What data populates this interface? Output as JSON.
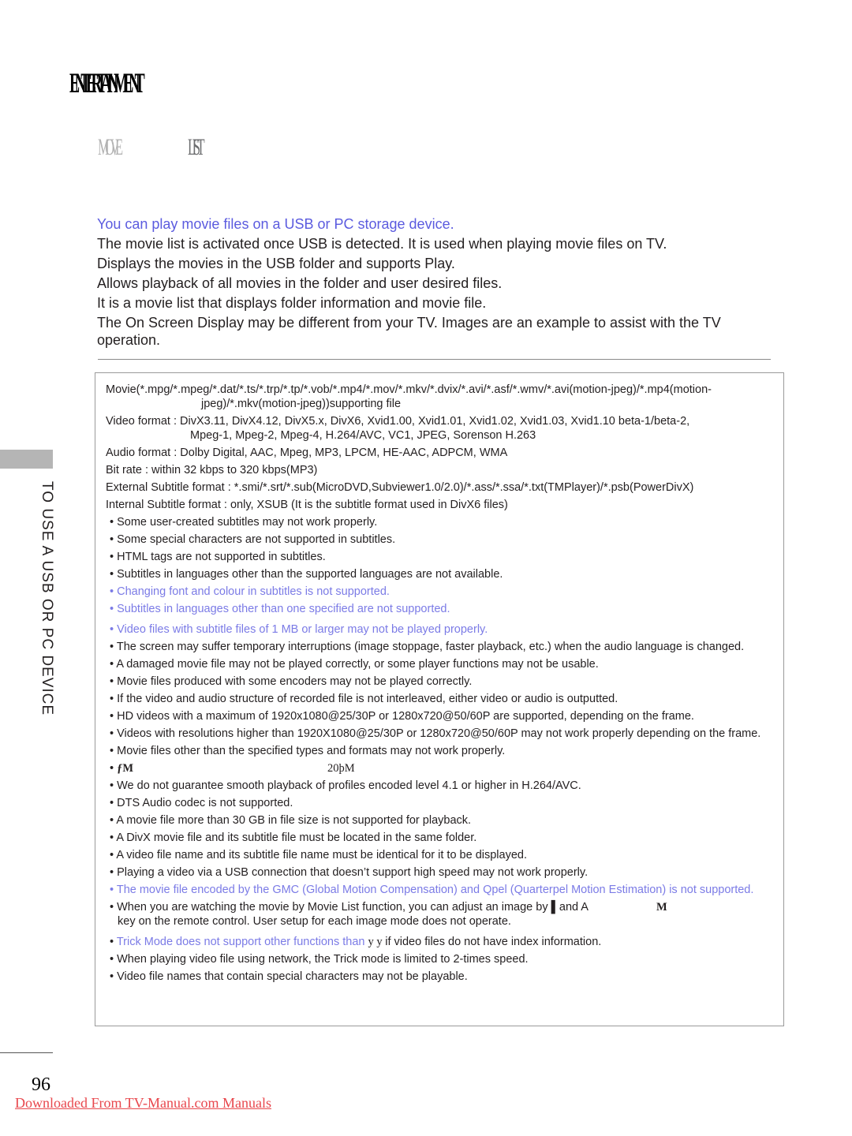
{
  "header": {
    "section_title": "ENTERTAINMENT",
    "subtitle_left": "MOVIE",
    "subtitle_right": "LIST"
  },
  "intro": {
    "lead": "You can play movie files on a USB or PC storage device.",
    "lines": [
      "The movie list is activated once USB is detected. It is used when playing movie files on TV.",
      "Displays the movies in the USB folder and supports Play.",
      "Allows playback of all movies in the folder and user desired files.",
      "It is a movie list that displays folder information and movie file.",
      "The On Screen Display may be different from your TV. Images are an example to assist with the TV operation."
    ]
  },
  "specs": {
    "movie_line1": "Movie(*.mpg/*.mpeg/*.dat/*.ts/*.trp/*.tp/*.vob/*.mp4/*.mov/*.mkv/*.dvix/*.avi/*.asf/*.wmv/*.avi(motion-jpeg)/*.mp4(motion-",
    "movie_line2": "jpeg)/*.mkv(motion-jpeg))supporting file",
    "video_line1": "Video format : DivX3.11, DivX4.12, DivX5.x, DivX6, Xvid1.00, Xvid1.01, Xvid1.02, Xvid1.03, Xvid1.10 beta-1/beta-2,",
    "video_line2": "Mpeg-1, Mpeg-2, Mpeg-4, H.264/AVC, VC1, JPEG, Sorenson H.263",
    "audio": "Audio format : Dolby Digital, AAC, Mpeg, MP3, LPCM, HE-AAC, ADPCM, WMA",
    "bitrate": "Bit rate : within 32 kbps to 320 kbps(MP3)",
    "ext_subtitle": "External Subtitle format : *.smi/*.srt/*.sub(MicroDVD,Subviewer1.0/2.0)/*.ass/*.ssa/*.txt(TMPlayer)/*.psb(PowerDivX)",
    "int_subtitle": "Internal Subtitle format : only, XSUB (It is the subtitle format used in DivX6 files)"
  },
  "bullets": [
    {
      "text": "Some user-created subtitles may not work properly.",
      "color": "black"
    },
    {
      "text": "Some special characters are not supported in subtitles.",
      "color": "black"
    },
    {
      "text": "HTML tags are not supported in subtitles.",
      "color": "black"
    },
    {
      "text": "Subtitles in languages other than the supported languages are not available.",
      "color": "black"
    },
    {
      "text": "Changing font and colour in subtitles is not supported.",
      "color": "blue"
    },
    {
      "text": "Subtitles in languages other than one specified are not supported.",
      "color": "blue"
    },
    {
      "text": "Video files with subtitle files of 1 MB or larger may not be played properly.",
      "color": "blue"
    },
    {
      "text": "The screen may suffer temporary interruptions (image stoppage, faster playback, etc.) when the audio language is changed.",
      "color": "black"
    },
    {
      "text": "A damaged movie file may not be played correctly, or some player functions may not be usable.",
      "color": "black"
    },
    {
      "text": "Movie files produced with some encoders may not be played correctly.",
      "color": "black"
    },
    {
      "text": "If the video and audio structure of recorded file is not interleaved, either video or audio is outputted.",
      "color": "black"
    },
    {
      "text": "HD videos with a maximum of 1920x1080@25/30P or 1280x720@50/60P are supported, depending on the frame.",
      "color": "black"
    },
    {
      "text": "Videos with resolutions higher than 1920X1080@25/30P or 1280x720@50/60P may not work properly depending on the frame.",
      "color": "black"
    },
    {
      "text": "Movie files other than the specified types and formats may not work properly.",
      "color": "black"
    },
    {
      "garbled_a": "ƒM",
      "garbled_b": "20þM",
      "color": "black"
    },
    {
      "text": "We do not guarantee smooth playback of profiles encoded level 4.1 or higher in H.264/AVC.",
      "color": "black"
    },
    {
      "text": "DTS Audio codec is not supported.",
      "color": "black"
    },
    {
      "text": "A movie file more than 30 GB in file size is not supported for playback.",
      "color": "black"
    },
    {
      "text": "A DivX movie file and its subtitle file must be located in the same folder.",
      "color": "black"
    },
    {
      "text": "A video file name and its subtitle file name must be identical for it to be displayed.",
      "color": "black"
    },
    {
      "text": "Playing a video via a USB connection that doesn’t support high speed may not work properly.",
      "color": "black"
    },
    {
      "text": "The movie file encoded by the GMC (Global Motion Compensation) and Qpel (Quarterpel Motion Estimation) is not supported.",
      "color": "blue"
    },
    {
      "text_a": "When you are watching the movie by Movie List function, you can adjust an image by ",
      "text_b": "and A",
      "text_c": "M",
      "text_d": "key on the remote control. User setup for each image mode does not operate.",
      "color": "black"
    },
    {
      "text_blue": "Trick Mode does not support other functions than ",
      "text_garble": "y y ",
      "text_black": " if video files do not have index information.",
      "color": "mixed"
    },
    {
      "text": "When playing video file using network, the Trick mode is limited to 2-times speed.",
      "color": "black"
    },
    {
      "text": "Video file names that contain special characters may not be playable.",
      "color": "black"
    }
  ],
  "sidebar": {
    "vertical_label": "TO USE A USB OR PC DEVICE"
  },
  "footer": {
    "page_number": "96",
    "download_link": "Downloaded From TV-Manual.com Manuals"
  },
  "colors": {
    "accent_blue": "#5b5bdf",
    "note_blue": "#7b7be6",
    "link_red": "#e8474d",
    "tab_gray": "#b5b5b5"
  }
}
